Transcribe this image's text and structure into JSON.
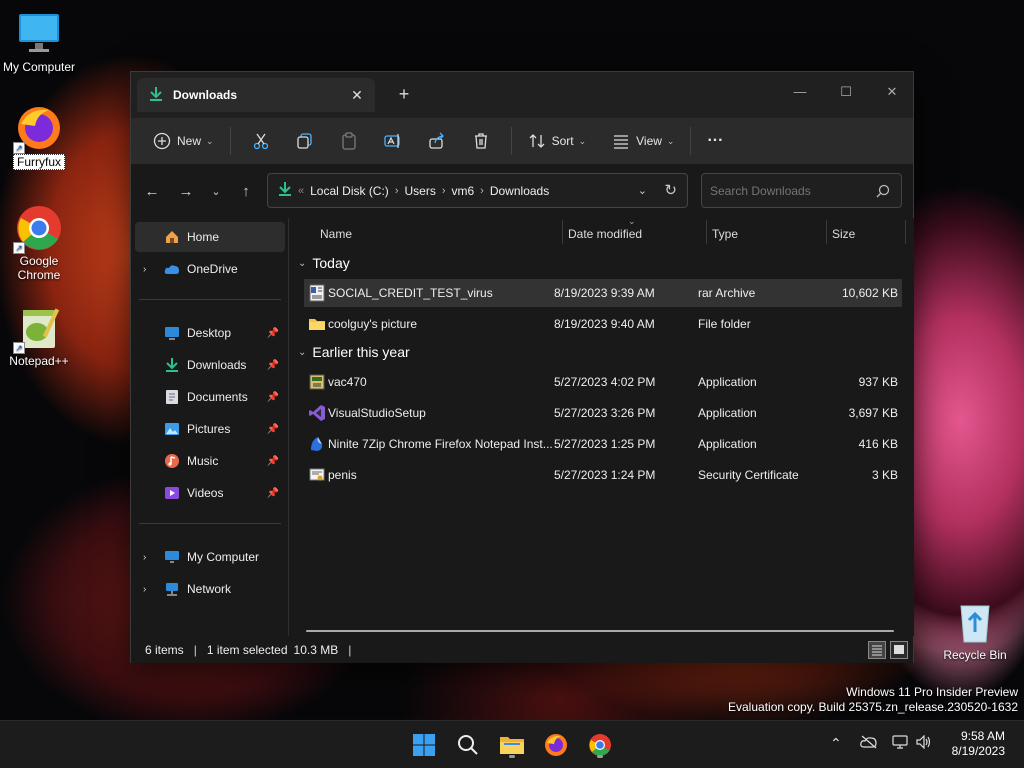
{
  "desktop": {
    "icons": [
      {
        "label": "My Computer"
      },
      {
        "label": "Furryfux"
      },
      {
        "label": "Google Chrome"
      },
      {
        "label": "Notepad++"
      },
      {
        "label": "Recycle Bin"
      }
    ],
    "watermark": {
      "line1": "Windows 11 Pro Insider Preview",
      "line2": "Evaluation copy. Build 25375.zn_release.230520-1632"
    }
  },
  "window": {
    "tab_title": "Downloads",
    "new_tab": "+",
    "controls": {
      "minimize": "—",
      "maximize": "☐",
      "close": "✕"
    },
    "commands": {
      "new_label": "New",
      "sort_label": "Sort",
      "view_label": "View",
      "more_label": "···"
    },
    "address": {
      "overflow": "«",
      "crumbs": [
        "Local Disk (C:)",
        "Users",
        "vm6",
        "Downloads"
      ],
      "sep": "›"
    },
    "search": {
      "placeholder": "Search Downloads"
    }
  },
  "sidebar": {
    "home": "Home",
    "onedrive": "OneDrive",
    "quick": [
      {
        "label": "Desktop"
      },
      {
        "label": "Downloads"
      },
      {
        "label": "Documents"
      },
      {
        "label": "Pictures"
      },
      {
        "label": "Music"
      },
      {
        "label": "Videos"
      }
    ],
    "this_pc": "My Computer",
    "network": "Network"
  },
  "files": {
    "columns": {
      "name": "Name",
      "date": "Date modified",
      "type": "Type",
      "size": "Size"
    },
    "groups": [
      {
        "title": "Today",
        "items": [
          {
            "name": "SOCIAL_CREDIT_TEST_virus",
            "date": "8/19/2023 9:39 AM",
            "type": "rar Archive",
            "size": "10,602 KB",
            "icon": "archive-icon"
          },
          {
            "name": "coolguy's picture",
            "date": "8/19/2023 9:40 AM",
            "type": "File folder",
            "size": "",
            "icon": "folder-icon"
          }
        ]
      },
      {
        "title": "Earlier this year",
        "items": [
          {
            "name": "vac470",
            "date": "5/27/2023 4:02 PM",
            "type": "Application",
            "size": "937 KB",
            "icon": "app-icon"
          },
          {
            "name": "VisualStudioSetup",
            "date": "5/27/2023 3:26 PM",
            "type": "Application",
            "size": "3,697 KB",
            "icon": "visual-studio-icon"
          },
          {
            "name": "Ninite 7Zip Chrome Firefox Notepad Inst...",
            "date": "5/27/2023 1:25 PM",
            "type": "Application",
            "size": "416 KB",
            "icon": "ninite-icon"
          },
          {
            "name": "penis",
            "date": "5/27/2023 1:24 PM",
            "type": "Security Certificate",
            "size": "3 KB",
            "icon": "certificate-icon"
          }
        ]
      }
    ]
  },
  "status": {
    "count": "6 items",
    "sep": "|",
    "selected": "1 item selected",
    "size": "10.3 MB"
  },
  "taskbar": {
    "time": "9:58 AM",
    "date": "8/19/2023",
    "apps": [
      "windows-start-icon",
      "search-icon",
      "file-explorer-icon",
      "firefox-icon",
      "chrome-icon"
    ]
  },
  "colors": {
    "accent": "#0f8a5f",
    "selection": "#333333",
    "window_bg": "#191919"
  }
}
